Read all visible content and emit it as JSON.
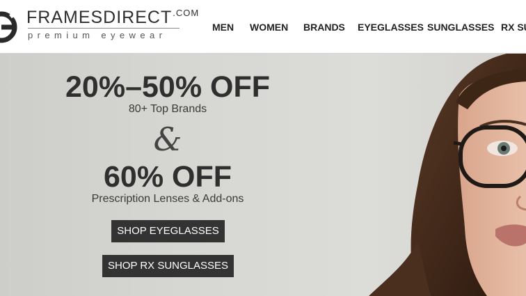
{
  "logo": {
    "name": "FRAMESDIRECT",
    "tld": ".COM",
    "tagline": "premium eyewear"
  },
  "nav": {
    "items": [
      "MEN",
      "WOMEN",
      "BRANDS",
      "EYEGLASSES",
      "SUNGLASSES",
      "RX SU"
    ]
  },
  "hero": {
    "headline_1": "20%–50% OFF",
    "subline_1": "80+ Top Brands",
    "ampersand": "&",
    "headline_2": "60% OFF",
    "subline_2": "Prescription Lenses & Add-ons",
    "cta_eyeglasses": "SHOP EYEGLASSES",
    "cta_rx_sunglasses": "SHOP RX SUNGLASSES"
  },
  "colors": {
    "header_bg": "#ffffff",
    "hero_bg": "#d6d6d3",
    "text_dark": "#2f2f2f",
    "button_bg": "#333333",
    "button_text": "#ffffff"
  }
}
